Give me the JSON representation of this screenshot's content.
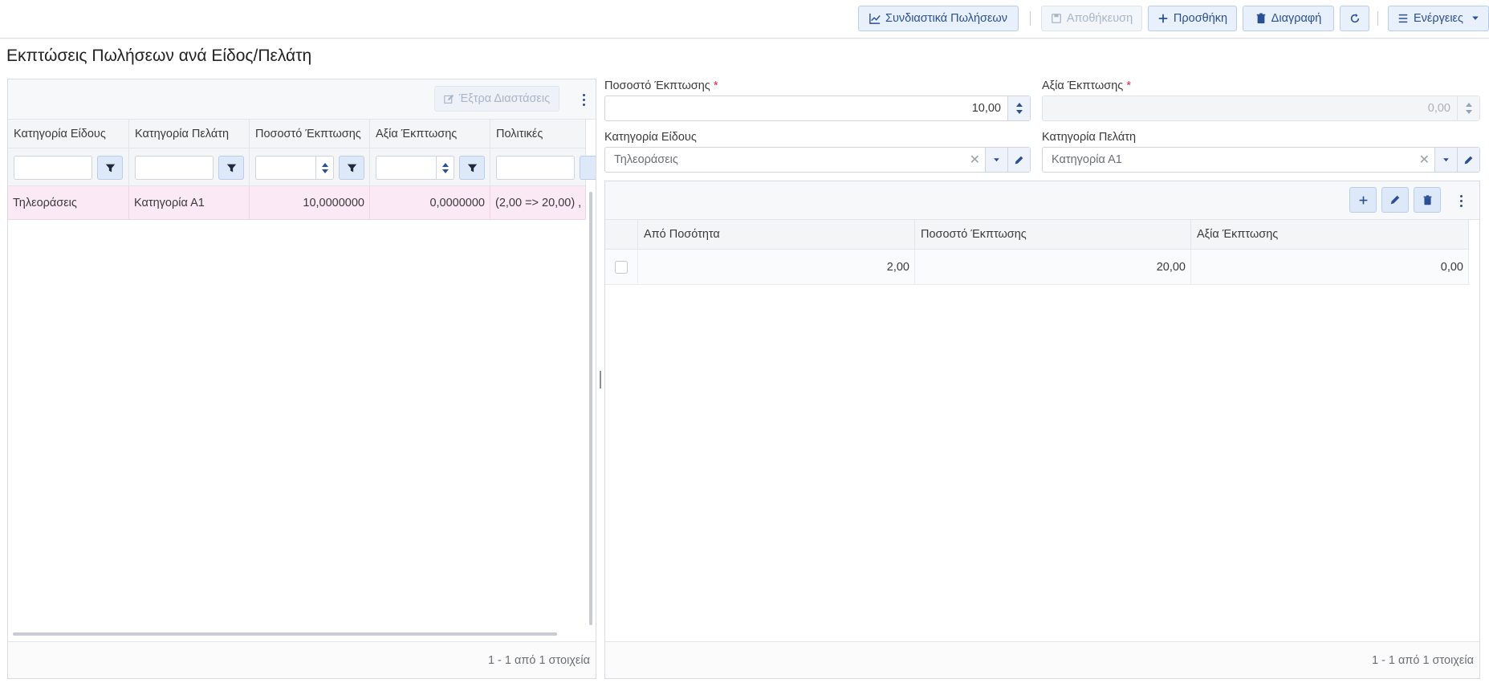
{
  "toolbar": {
    "sales_combo_label": "Συνδιαστικά Πωλήσεων",
    "save_label": "Αποθήκευση",
    "add_label": "Προσθήκη",
    "delete_label": "Διαγραφή",
    "actions_label": "Ενέργειες"
  },
  "page": {
    "title": "Εκπτώσεις Πωλήσεων ανά Είδος/Πελάτη"
  },
  "left_grid": {
    "extra_dimensions_label": "Έξτρα Διαστάσεις",
    "columns": [
      "Κατηγορία Είδους",
      "Κατηγορία Πελάτη",
      "Ποσοστό Έκπτωσης",
      "Αξία Έκπτωσης",
      "Πολιτικές"
    ],
    "rows": [
      {
        "item_category": "Τηλεοράσεις",
        "customer_category": "Κατηγορία Α1",
        "discount_percent": "10,0000000",
        "discount_value": "0,0000000",
        "policies": "(2,00 => 20,00) ,"
      }
    ],
    "pager_text": "1 - 1 από 1 στοιχεία"
  },
  "form": {
    "discount_percent_label": "Ποσοστό Έκπτωσης",
    "discount_percent_value": "10,00",
    "discount_value_label": "Αξία Έκπτωσης",
    "discount_value_value": "0,00",
    "required_mark": "*",
    "item_category_label": "Κατηγορία Είδους",
    "item_category_value": "Τηλεοράσεις",
    "customer_category_label": "Κατηγορία Πελάτη",
    "customer_category_value": "Κατηγορία Α1",
    "clear_glyph": "✕"
  },
  "policy_grid": {
    "columns": [
      "Από Ποσότητα",
      "Ποσοστό Έκπτωσης",
      "Αξία Έκπτωσης"
    ],
    "rows": [
      {
        "from_quantity": "2,00",
        "discount_percent": "20,00",
        "discount_value": "0,00"
      }
    ],
    "pager_text": "1 - 1 από 1 στοιχεία"
  },
  "colors": {
    "accent": "#2a4f93",
    "button_bg": "#e8f0fc",
    "selected_row": "#fbe9f5",
    "required": "#e0234d"
  },
  "icons": [
    "chart-line-icon",
    "save-icon",
    "plus-icon",
    "trash-icon",
    "refresh-icon",
    "menu-icon",
    "chevron-down-icon",
    "edit-icon",
    "filter-icon",
    "kebab-icon"
  ]
}
